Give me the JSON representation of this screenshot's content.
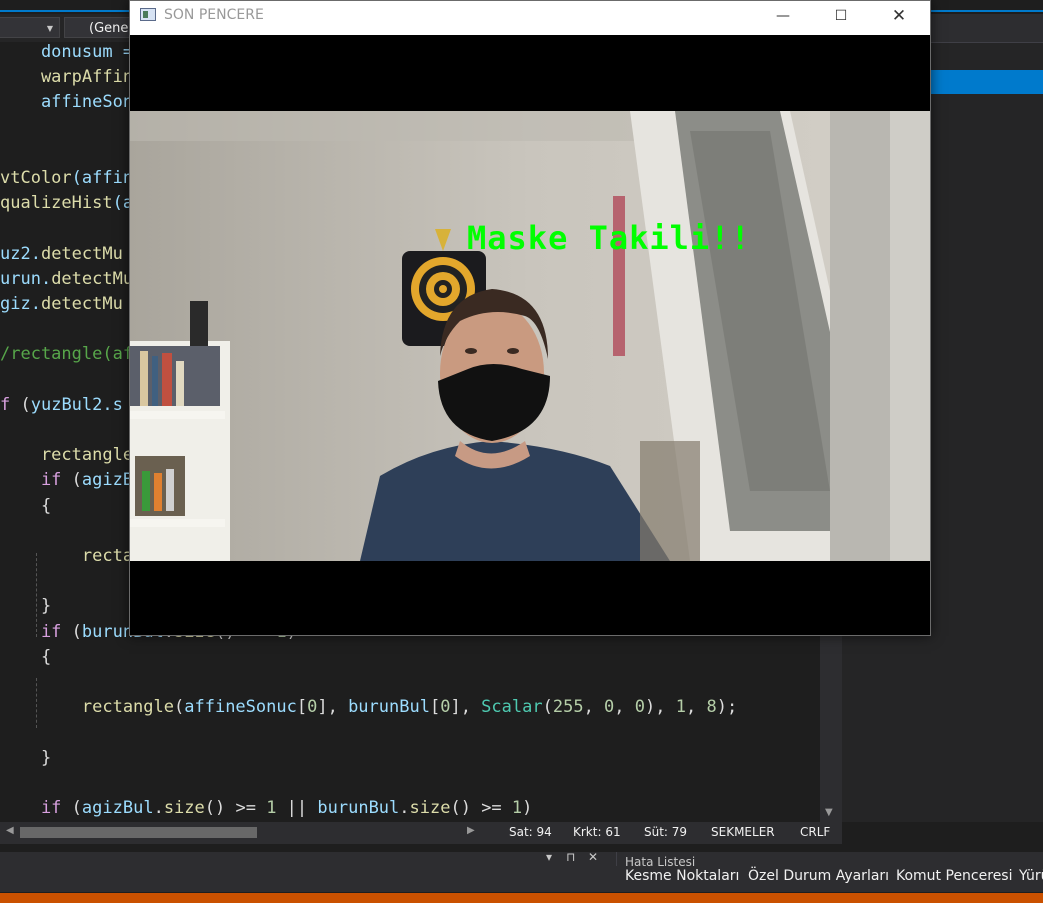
{
  "ide": {
    "nav_combo_label": "(Gene",
    "code_lines": [
      {
        "parts": [
          {
            "t": "    donusum = ",
            "c": "#9cdcfe"
          }
        ]
      },
      {
        "parts": [
          {
            "t": "    warpAffine",
            "c": "#dcdcaa"
          }
        ]
      },
      {
        "parts": [
          {
            "t": "    affineSonu",
            "c": "#9cdcfe"
          }
        ]
      },
      {
        "parts": []
      },
      {
        "parts": []
      },
      {
        "parts": [
          {
            "t": "vtColor",
            "c": "#dcdcaa"
          },
          {
            "t": "(affin",
            "c": "#9cdcfe"
          }
        ]
      },
      {
        "parts": [
          {
            "t": "qualizeHist",
            "c": "#dcdcaa"
          },
          {
            "t": "(a",
            "c": "#9cdcfe"
          }
        ]
      },
      {
        "parts": []
      },
      {
        "parts": [
          {
            "t": "uz2.",
            "c": "#9cdcfe"
          },
          {
            "t": "detectMu",
            "c": "#dcdcaa"
          }
        ]
      },
      {
        "parts": [
          {
            "t": "urun.",
            "c": "#9cdcfe"
          },
          {
            "t": "detectMu",
            "c": "#dcdcaa"
          }
        ]
      },
      {
        "parts": [
          {
            "t": "giz.",
            "c": "#9cdcfe"
          },
          {
            "t": "detectMu",
            "c": "#dcdcaa"
          }
        ]
      },
      {
        "parts": []
      },
      {
        "parts": [
          {
            "t": "/rectangle(af",
            "c": "#57a64a"
          }
        ]
      },
      {
        "parts": []
      },
      {
        "parts": [
          {
            "t": "f ",
            "c": "#d8a0df"
          },
          {
            "t": "(",
            "c": "#dcdcdc"
          },
          {
            "t": "yuzBul2.s",
            "c": "#9cdcfe"
          }
        ]
      },
      {
        "parts": []
      },
      {
        "parts": [
          {
            "t": "    rectangle",
            "c": "#dcdcaa"
          }
        ]
      },
      {
        "parts": [
          {
            "t": "    if ",
            "c": "#d8a0df"
          },
          {
            "t": "(",
            "c": "#dcdcdc"
          },
          {
            "t": "agizBu",
            "c": "#9cdcfe"
          }
        ]
      },
      {
        "parts": [
          {
            "t": "    {",
            "c": "#dcdcdc"
          }
        ]
      },
      {
        "parts": []
      },
      {
        "parts": [
          {
            "t": "        rectan",
            "c": "#dcdcaa"
          }
        ]
      },
      {
        "parts": []
      },
      {
        "parts": [
          {
            "t": "    }",
            "c": "#dcdcdc"
          }
        ]
      },
      {
        "parts": [
          {
            "t": "    if ",
            "c": "#d8a0df"
          },
          {
            "t": "(",
            "c": "#dcdcdc"
          },
          {
            "t": "burunBul",
            "c": "#9cdcfe"
          },
          {
            "t": ".",
            "c": "#dcdcdc"
          },
          {
            "t": "size",
            "c": "#dcdcaa"
          },
          {
            "t": "() >= ",
            "c": "#dcdcdc"
          },
          {
            "t": "1",
            "c": "#b5cea8"
          },
          {
            "t": ")",
            "c": "#dcdcdc"
          }
        ]
      },
      {
        "parts": [
          {
            "t": "    {",
            "c": "#dcdcdc"
          }
        ]
      },
      {
        "parts": []
      },
      {
        "parts": [
          {
            "t": "        rectangle",
            "c": "#dcdcaa"
          },
          {
            "t": "(",
            "c": "#dcdcdc"
          },
          {
            "t": "affineSonuc",
            "c": "#9cdcfe"
          },
          {
            "t": "[",
            "c": "#dcdcdc"
          },
          {
            "t": "0",
            "c": "#b5cea8"
          },
          {
            "t": "], ",
            "c": "#dcdcdc"
          },
          {
            "t": "burunBul",
            "c": "#9cdcfe"
          },
          {
            "t": "[",
            "c": "#dcdcdc"
          },
          {
            "t": "0",
            "c": "#b5cea8"
          },
          {
            "t": "], ",
            "c": "#dcdcdc"
          },
          {
            "t": "Scalar",
            "c": "#4ec9b0"
          },
          {
            "t": "(",
            "c": "#dcdcdc"
          },
          {
            "t": "255",
            "c": "#b5cea8"
          },
          {
            "t": ", ",
            "c": "#dcdcdc"
          },
          {
            "t": "0",
            "c": "#b5cea8"
          },
          {
            "t": ", ",
            "c": "#dcdcdc"
          },
          {
            "t": "0",
            "c": "#b5cea8"
          },
          {
            "t": "), ",
            "c": "#dcdcdc"
          },
          {
            "t": "1",
            "c": "#b5cea8"
          },
          {
            "t": ", ",
            "c": "#dcdcdc"
          },
          {
            "t": "8",
            "c": "#b5cea8"
          },
          {
            "t": ");",
            "c": "#dcdcdc"
          }
        ]
      },
      {
        "parts": []
      },
      {
        "parts": [
          {
            "t": "    }",
            "c": "#dcdcdc"
          }
        ]
      },
      {
        "parts": []
      },
      {
        "parts": [
          {
            "t": "    if ",
            "c": "#d8a0df"
          },
          {
            "t": "(",
            "c": "#dcdcdc"
          },
          {
            "t": "agizBul",
            "c": "#9cdcfe"
          },
          {
            "t": ".",
            "c": "#dcdcdc"
          },
          {
            "t": "size",
            "c": "#dcdcaa"
          },
          {
            "t": "() >= ",
            "c": "#dcdcdc"
          },
          {
            "t": "1",
            "c": "#b5cea8"
          },
          {
            "t": " || ",
            "c": "#dcdcdc"
          },
          {
            "t": "burunBul",
            "c": "#9cdcfe"
          },
          {
            "t": ".",
            "c": "#dcdcdc"
          },
          {
            "t": "size",
            "c": "#dcdcaa"
          },
          {
            "t": "() >= ",
            "c": "#dcdcdc"
          },
          {
            "t": "1",
            "c": "#b5cea8"
          },
          {
            "t": ")",
            "c": "#dcdcdc"
          }
        ]
      },
      {
        "parts": [
          {
            "t": "    {",
            "c": "#dcdcdc"
          }
        ]
      }
    ]
  },
  "status": {
    "line": "Sat: 94",
    "char": "Krkt: 61",
    "col": "Süt: 79",
    "indent": "SEKMELER",
    "eol": "CRLF"
  },
  "panel": {
    "hata_tab": "Hata Listesi"
  },
  "bottom_tabs": [
    "Kesme Noktaları",
    "Özel Durum Ayarları",
    "Komut Penceresi",
    "Yürü"
  ],
  "window": {
    "title": "SON PENCERE",
    "overlay_text": "Maske Takili!!",
    "overlay_color": "#00ff00"
  },
  "icons": {
    "minimize": "minimize-icon",
    "maximize": "maximize-icon",
    "close": "close-icon",
    "app": "opencv-window-icon"
  },
  "colors": {
    "accent": "#007acc",
    "status_orange": "#ca5100",
    "editor_bg": "#1e1e1e"
  }
}
